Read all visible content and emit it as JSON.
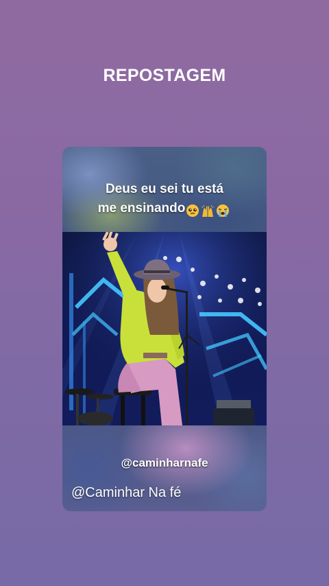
{
  "header": {
    "title": "REPOSTAGEM"
  },
  "post": {
    "caption_line1": "Deus eu sei tu está",
    "caption_line2": "me ensinando",
    "caption_emojis": [
      "pleading-face-icon",
      "raised-hands-icon",
      "loudly-crying-face-icon"
    ],
    "photo_description_icon": "singer-on-stage-image",
    "watermark": "@caminharnafe",
    "footer": "@Caminhar Na fé"
  },
  "colors": {
    "background_top": "#8f6aa0",
    "background_bottom": "#776aa6",
    "sweater": "#c9e03a",
    "pants": "#d79ac3",
    "stage": "#101a55"
  }
}
